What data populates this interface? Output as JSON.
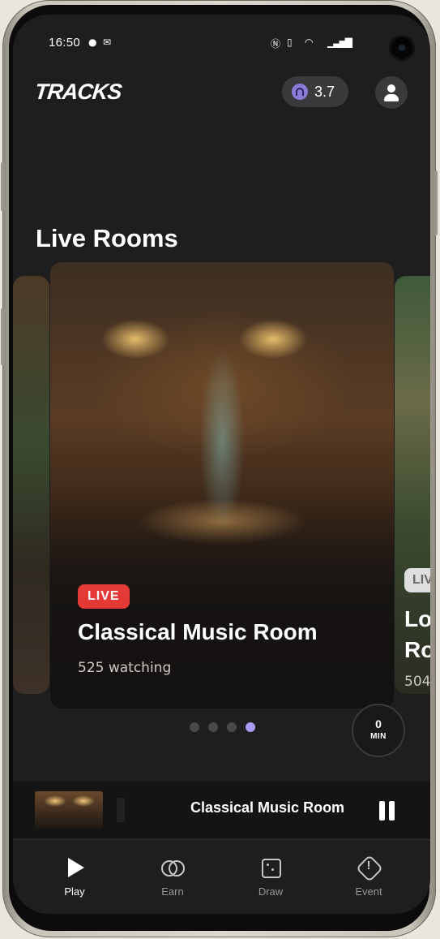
{
  "status_bar": {
    "time": "16:50",
    "left_icons": [
      "chat-bubble-icon",
      "mail-icon"
    ],
    "right_icons": [
      "nfc-icon",
      "vibrate-icon",
      "wifi-icon",
      "signal-icon"
    ]
  },
  "header": {
    "logo": "TRACKS",
    "points_value": "3.7",
    "points_icon": "headphones-icon",
    "profile_icon": "user-icon"
  },
  "section": {
    "title": "Live Rooms"
  },
  "cards": [
    {
      "badge": "LIVE",
      "title": "Classical Music Room",
      "subtitle": "525 watching"
    },
    {
      "badge": "LIV",
      "title_line1": "Lo",
      "title_line2": "Ro",
      "subtitle": "504"
    }
  ],
  "carousel": {
    "dot_count": 4,
    "active_index": 3
  },
  "timer": {
    "value": "0",
    "unit": "MIN"
  },
  "mini_player": {
    "title": "Classical Music Room",
    "control": "pause-icon"
  },
  "tabs": [
    {
      "label": "Play",
      "icon": "play-icon",
      "active": true
    },
    {
      "label": "Earn",
      "icon": "earn-icon",
      "active": false
    },
    {
      "label": "Draw",
      "icon": "dice-icon",
      "active": false
    },
    {
      "label": "Event",
      "icon": "event-icon",
      "active": false
    }
  ],
  "colors": {
    "background": "#1f1e1e",
    "live_badge": "#e53935",
    "accent": "#a99cf0",
    "points_icon": "#8c7bd9"
  }
}
